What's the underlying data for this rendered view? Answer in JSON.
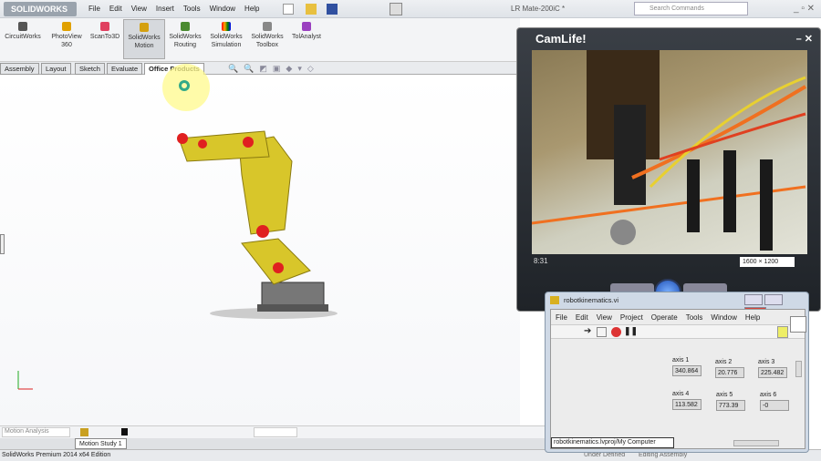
{
  "app": {
    "logo": "SOLIDWORKS",
    "menu": [
      "File",
      "Edit",
      "View",
      "Insert",
      "Tools",
      "Window",
      "Help"
    ],
    "document_title": "LR Mate-200iC *",
    "search_placeholder": "Search Commands"
  },
  "command_manager": {
    "items": [
      {
        "label": "CircuitWorks",
        "color": "#555555"
      },
      {
        "label": "PhotoView 360",
        "color": "#e0a000"
      },
      {
        "label": "ScanTo3D",
        "color": "#e04060"
      },
      {
        "label": "SolidWorks Motion",
        "color": "#d4a010",
        "active": true
      },
      {
        "label": "SolidWorks Routing",
        "color": "#4a8a30"
      },
      {
        "label": "SolidWorks Simulation",
        "color": "#e05020"
      },
      {
        "label": "SolidWorks Toolbox",
        "color": "#888888"
      },
      {
        "label": "TolAnalyst",
        "color": "#9a40c0"
      }
    ],
    "tabs": [
      "Assembly",
      "Layout",
      "Sketch",
      "Evaluate",
      "Office Products"
    ],
    "selected_tab": "Office Products"
  },
  "motion": {
    "study_type": "Motion Analysis",
    "study_tab": "Motion Study 1"
  },
  "status": {
    "edition": "SolidWorks Premium 2014 x64 Edition",
    "state1": "Under Defined",
    "state2": "Editing Assembly"
  },
  "camlife": {
    "title": "CamLife!",
    "time": "8:31",
    "resolution": "1600 × 1200"
  },
  "labview": {
    "title": "robotkinematics.vi",
    "menu": [
      "File",
      "Edit",
      "View",
      "Project",
      "Operate",
      "Tools",
      "Window",
      "Help"
    ],
    "axes": [
      {
        "label": "axis 1",
        "value": "340.864"
      },
      {
        "label": "axis 2",
        "value": "20.776"
      },
      {
        "label": "axis 3",
        "value": "225.482"
      },
      {
        "label": "axis 4",
        "value": "113.582"
      },
      {
        "label": "axis 5",
        "value": "773.39"
      },
      {
        "label": "axis 6",
        "value": "-0"
      }
    ],
    "path": "robotkinematics.lvproj/My Computer"
  },
  "colors": {
    "robot": "#d8c62a",
    "joints": "#e02020",
    "labview_close": "#d9443a"
  }
}
